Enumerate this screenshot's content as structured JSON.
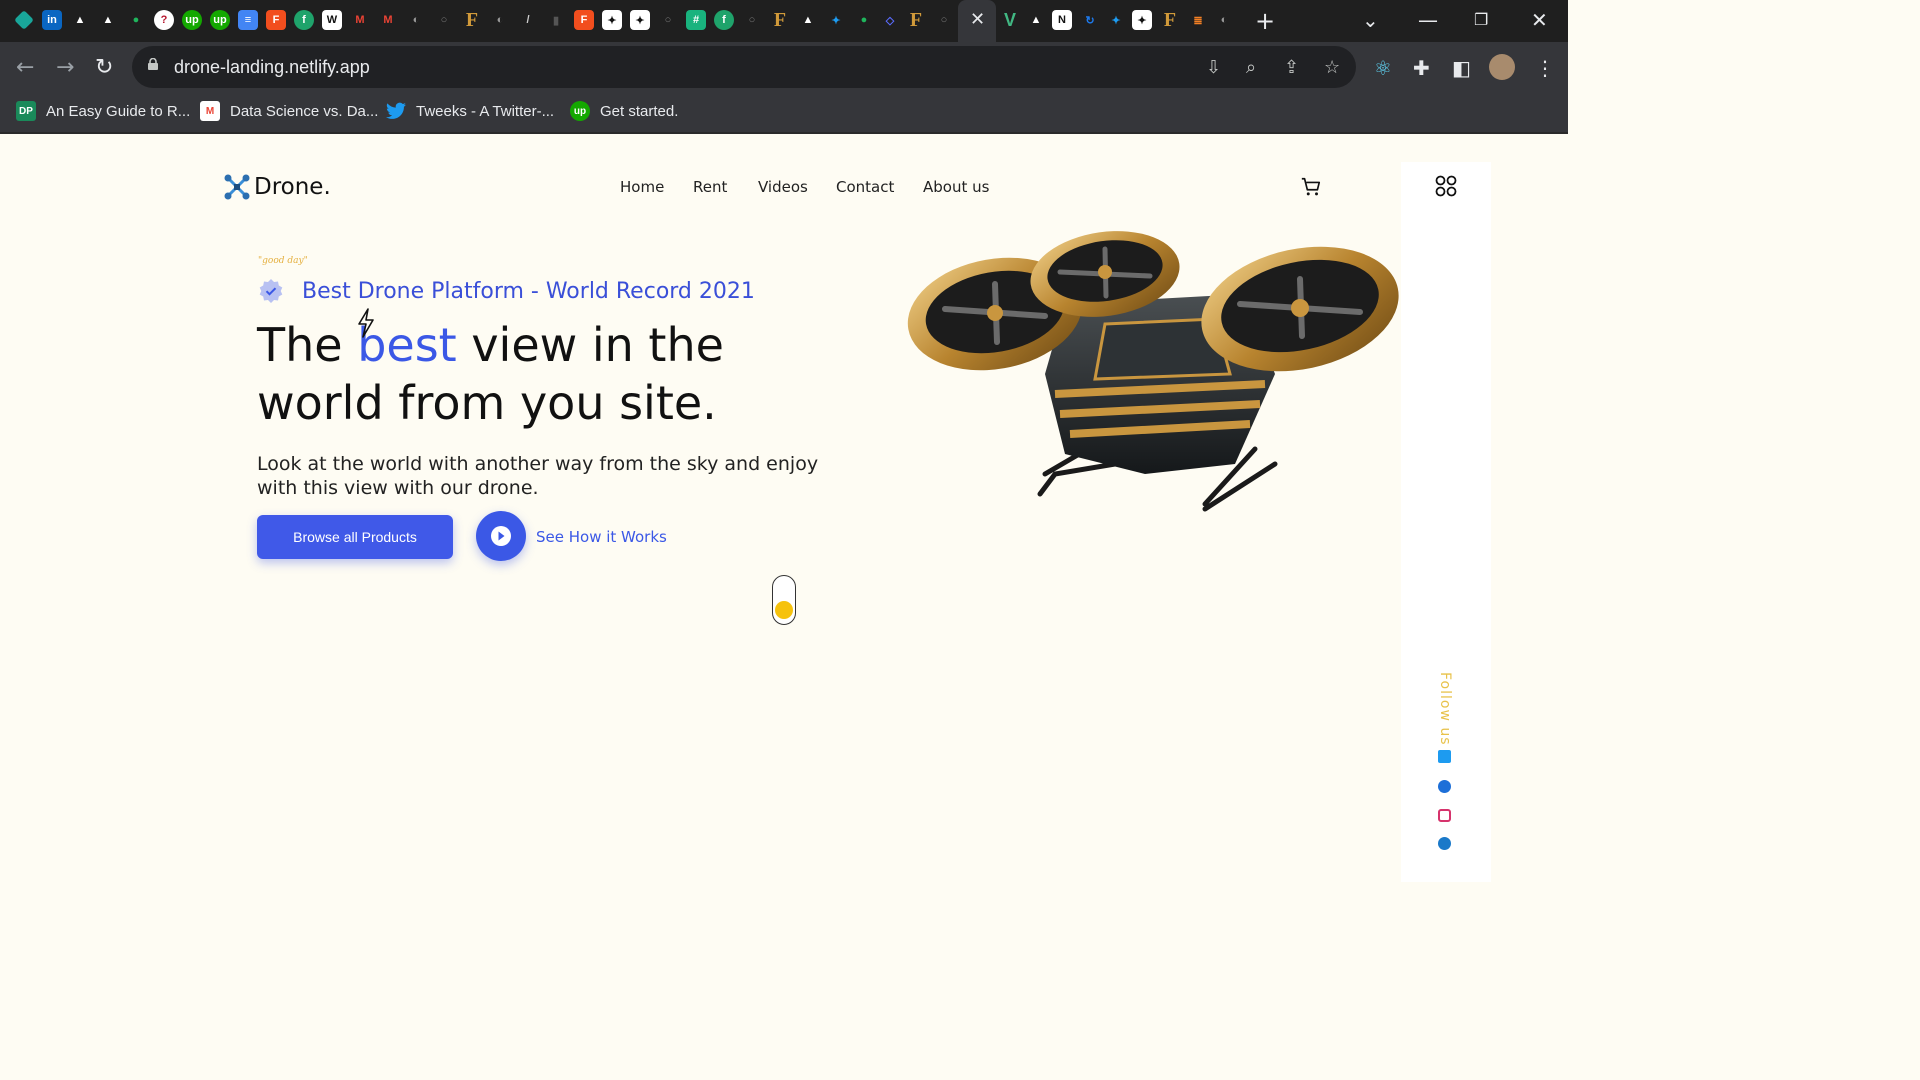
{
  "browser": {
    "url": "drone-landing.netlify.app",
    "tab_close": "✕",
    "new_tab": "+",
    "bookmarks": [
      {
        "label": "An Easy Guide to R...",
        "icon": "dp-icon",
        "color": "#1a8a5a",
        "glyph": "DP"
      },
      {
        "label": "Data Science vs. Da...",
        "icon": "gmail-icon",
        "color": "#ffffff",
        "glyph": "M"
      },
      {
        "label": "Tweeks - A Twitter-...",
        "icon": "twitter-icon",
        "color": "#1d9bf0",
        "glyph": ""
      },
      {
        "label": "Get started.",
        "icon": "upwork-icon",
        "color": "#14a800",
        "glyph": "up"
      }
    ]
  },
  "site": {
    "logo_text": "Drone.",
    "nav": [
      "Home",
      "Rent",
      "Videos",
      "Contact",
      "About us"
    ],
    "good_day": "\"good day\"",
    "badge_text": "Best Drone Platform - World Record 2021",
    "headline_pre": "The ",
    "headline_accent": "best",
    "headline_post": " view in the",
    "headline_line2": "world from you site.",
    "lead": "Look at the world with another way from the sky and enjoy with this view with our drone.",
    "cta_label": "Browse all Products",
    "how_label": "See How it Works",
    "follow_label": "Follow us"
  },
  "colors": {
    "accent": "#3b58e6",
    "page_bg": "#fefcf3",
    "scroll_dot": "#f6c20d",
    "follow": "#e8c24a"
  }
}
